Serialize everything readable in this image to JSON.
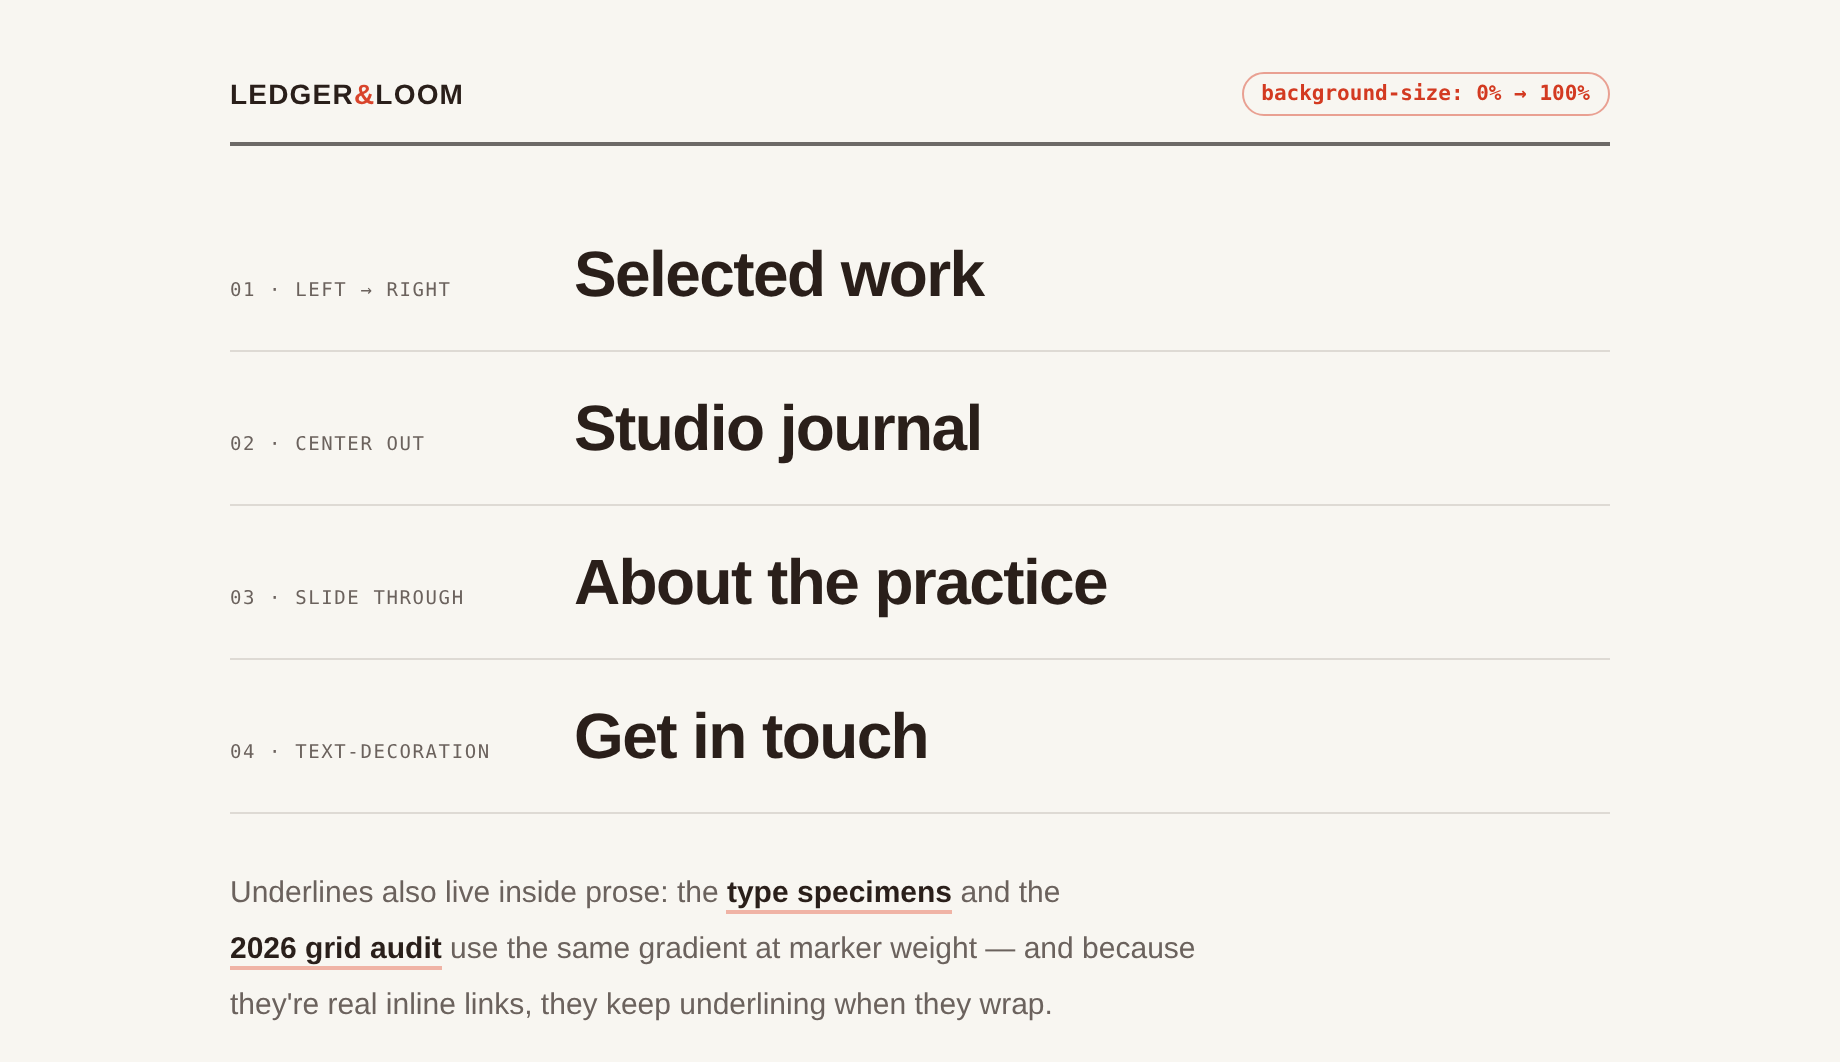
{
  "logo": {
    "before": "LEDGER",
    "amp": "&",
    "after": "LOOM"
  },
  "badge": "background-size: 0% → 100%",
  "nav": [
    {
      "label": "01 · LEFT → RIGHT",
      "title": "Selected work"
    },
    {
      "label": "02 · CENTER OUT",
      "title": "Studio journal"
    },
    {
      "label": "03 · SLIDE THROUGH",
      "title": "About the practice"
    },
    {
      "label": "04 · TEXT-DECORATION",
      "title": "Get in touch"
    }
  ],
  "prose": [
    {
      "kind": "text",
      "text": "Underlines also live inside prose: the "
    },
    {
      "kind": "link",
      "text": "type specimens"
    },
    {
      "kind": "text",
      "text": " and the "
    },
    {
      "kind": "link",
      "text": "2026 grid audit"
    },
    {
      "kind": "text",
      "text": " use the same gradient at marker weight — and because they're real inline links, they keep underlining when they wrap."
    }
  ]
}
